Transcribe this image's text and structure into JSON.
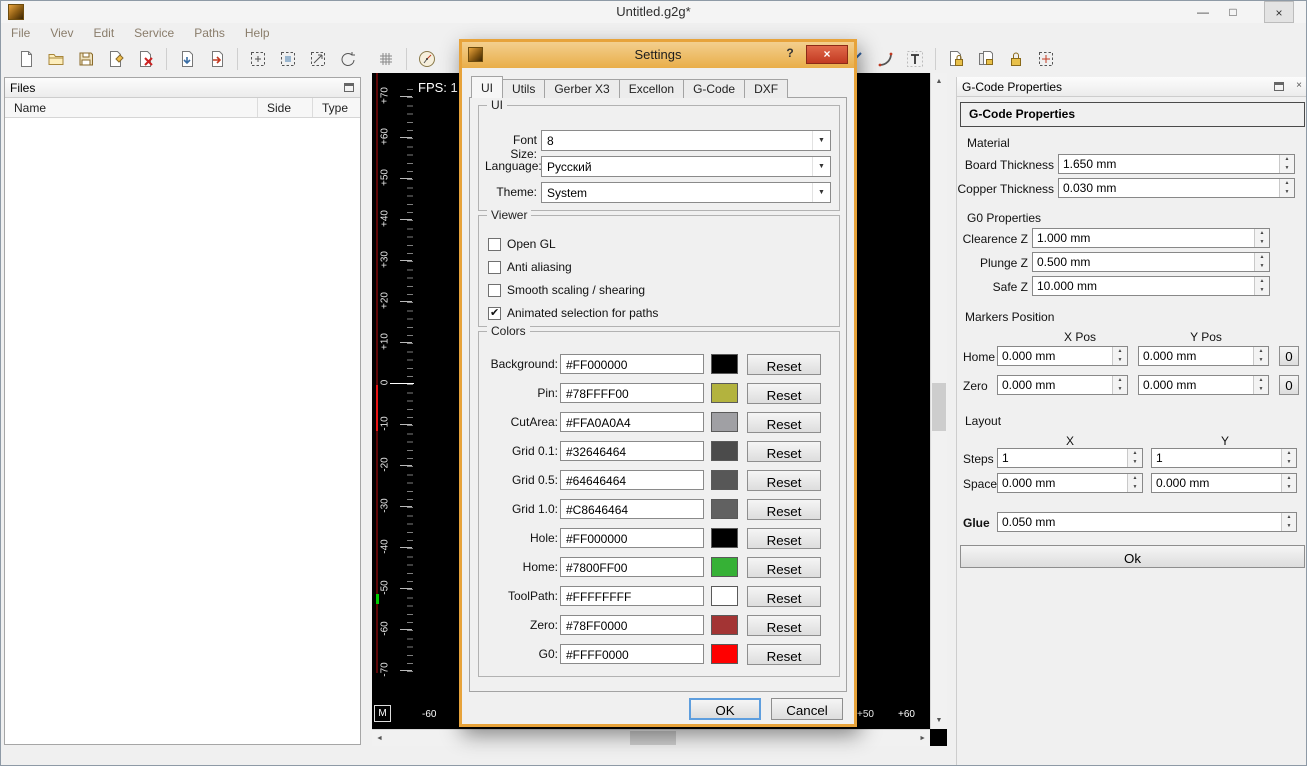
{
  "icons": {
    "minimize": "—",
    "maximize": "□",
    "close": "×",
    "help": "?",
    "dropdown_arrow": "▼",
    "scroll_up": "▲",
    "scroll_down": "▼",
    "scroll_left": "◄",
    "scroll_right": "►"
  },
  "window": {
    "title": "Untitled.g2g*",
    "menu": [
      "File",
      "Viev",
      "Edit",
      "Service",
      "Paths",
      "Help"
    ]
  },
  "files_panel": {
    "title": "Files",
    "columns": [
      "Name",
      "Side",
      "Type"
    ]
  },
  "viewport": {
    "fps": "FPS: 1",
    "ruler_v": [
      "+70",
      "+60",
      "+50",
      "+40",
      "+30",
      "+20",
      "+10",
      "0",
      "-10",
      "-20",
      "-30",
      "-40",
      "-50",
      "-60",
      "-70"
    ],
    "marker": "M",
    "ruler_h_left": "-60",
    "ruler_h_right1": "+50",
    "ruler_h_right2": "+60"
  },
  "gcode_panel": {
    "title": "G-Code Properties",
    "header": "G-Code Properties",
    "material_title": "Material",
    "board_label": "Board Thickness",
    "board_value": "1.650 mm",
    "copper_label": "Copper Thickness",
    "copper_value": "0.030 mm",
    "g0_title": "G0 Properties",
    "clearence_label": "Clearence Z",
    "clearence_value": "1.000 mm",
    "plunge_label": "Plunge Z",
    "plunge_value": "0.500 mm",
    "safe_label": "Safe Z",
    "safe_value": "10.000 mm",
    "markers_title": "Markers Position",
    "xpos_label": "X Pos",
    "ypos_label": "Y Pos",
    "home_label": "Home",
    "home_x": "0.000 mm",
    "home_y": "0.000 mm",
    "home_zero_btn": "0",
    "zero_label": "Zero",
    "zero_x": "0.000 mm",
    "zero_y": "0.000 mm",
    "zero_zero_btn": "0",
    "layout_title": "Layout",
    "x_label": "X",
    "y_label": "Y",
    "steps_label": "Steps",
    "steps_x": "1",
    "steps_y": "1",
    "space_label": "Space",
    "space_x": "0.000 mm",
    "space_y": "0.000 mm",
    "glue_label": "Glue",
    "glue_value": "0.050 mm",
    "ok_label": "Ok"
  },
  "dialog": {
    "title": "Settings",
    "tabs": [
      "UI",
      "Utils",
      "Gerber X3",
      "Excellon",
      "G-Code",
      "DXF"
    ],
    "active_tab": "UI",
    "ui_group": {
      "title": "UI",
      "font_size_label": "Font Size:",
      "font_size_value": "8",
      "language_label": "Language:",
      "language_value": "Русский",
      "theme_label": "Theme:",
      "theme_value": "System"
    },
    "viewer_group": {
      "title": "Viewer",
      "checkboxes": [
        {
          "label": "Open GL",
          "checked": false
        },
        {
          "label": "Anti aliasing",
          "checked": false
        },
        {
          "label": "Smooth scaling / shearing",
          "checked": false
        },
        {
          "label": "Animated selection for paths",
          "checked": true
        }
      ]
    },
    "colors_group": {
      "title": "Colors",
      "reset_label": "Reset",
      "rows": [
        {
          "label": "Background:",
          "value": "#FF000000",
          "swatch": "#000000"
        },
        {
          "label": "Pin:",
          "value": "#78FFFF00",
          "swatch": "#b3b33e"
        },
        {
          "label": "CutArea:",
          "value": "#FFA0A0A4",
          "swatch": "#a0a0a4"
        },
        {
          "label": "Grid 0.1:",
          "value": "#32646464",
          "swatch": "#4b4b4b"
        },
        {
          "label": "Grid 0.5:",
          "value": "#64646464",
          "swatch": "#575757"
        },
        {
          "label": "Grid 1.0:",
          "value": "#C8646464",
          "swatch": "#616161"
        },
        {
          "label": "Hole:",
          "value": "#FF000000",
          "swatch": "#000000"
        },
        {
          "label": "Home:",
          "value": "#7800FF00",
          "swatch": "#36b136"
        },
        {
          "label": "ToolPath:",
          "value": "#FFFFFFFF",
          "swatch": "#ffffff"
        },
        {
          "label": "Zero:",
          "value": "#78FF0000",
          "swatch": "#a33434"
        },
        {
          "label": "G0:",
          "value": "#FFFF0000",
          "swatch": "#ff0000"
        }
      ]
    },
    "ok_label": "OK",
    "cancel_label": "Cancel"
  }
}
